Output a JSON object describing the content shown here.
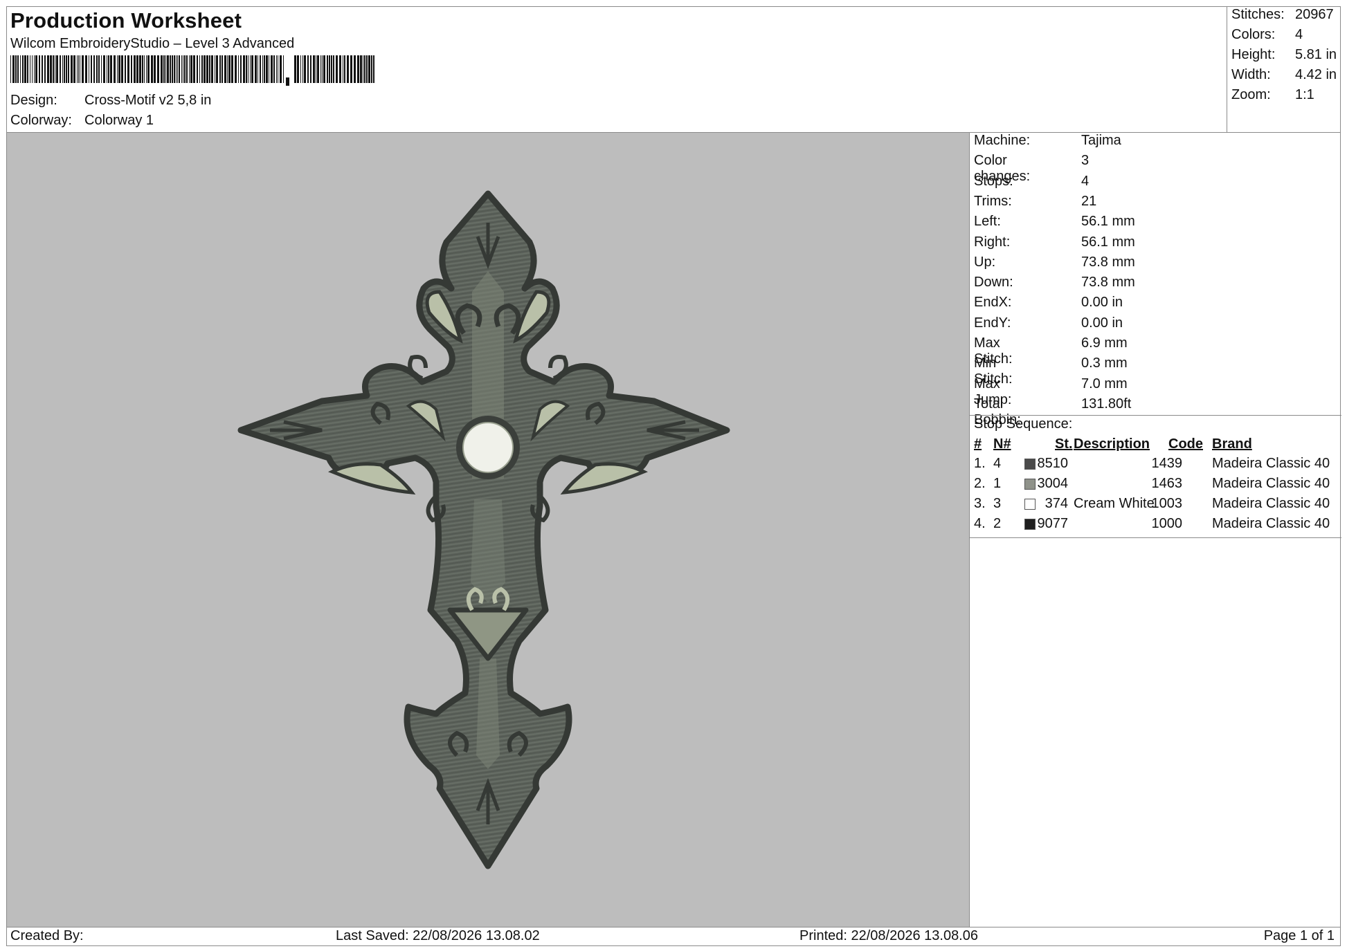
{
  "header": {
    "title": "Production Worksheet",
    "subtitle": "Wilcom EmbroideryStudio – Level 3 Advanced",
    "design_label": "Design:",
    "design_value": "Cross-Motif v2 5,8 in",
    "colorway_label": "Colorway:",
    "colorway_value": "Colorway 1"
  },
  "summary": [
    {
      "label": "Stitches:",
      "value": "20967"
    },
    {
      "label": "Colors:",
      "value": "4"
    },
    {
      "label": "Height:",
      "value": "5.81 in"
    },
    {
      "label": "Width:",
      "value": "4.42 in"
    },
    {
      "label": "Zoom:",
      "value": "1:1"
    }
  ],
  "machine_info": [
    {
      "label": "Machine:",
      "value": "Tajima"
    },
    {
      "label": "Color changes:",
      "value": "3"
    },
    {
      "label": "Stops:",
      "value": "4"
    },
    {
      "label": "Trims:",
      "value": "21"
    },
    {
      "label": "Left:",
      "value": "56.1 mm"
    },
    {
      "label": "Right:",
      "value": "56.1 mm"
    },
    {
      "label": "Up:",
      "value": "73.8 mm"
    },
    {
      "label": "Down:",
      "value": "73.8 mm"
    },
    {
      "label": "EndX:",
      "value": "0.00 in"
    },
    {
      "label": "EndY:",
      "value": "0.00 in"
    },
    {
      "label": "Max Stitch:",
      "value": "6.9 mm"
    },
    {
      "label": "Min Stitch:",
      "value": "0.3 mm"
    },
    {
      "label": "Max Jump:",
      "value": "7.0 mm"
    },
    {
      "label": "Total Bobbin:",
      "value": "131.80ft"
    }
  ],
  "stop_sequence": {
    "title": "Stop Sequence:",
    "headers": {
      "num": "#",
      "n": "N#",
      "st": "St.",
      "description": "Description",
      "code": "Code",
      "brand": "Brand"
    },
    "rows": [
      {
        "num": "1.",
        "n": "4",
        "color": "#4a4a4a",
        "st": "8510",
        "description": "",
        "code": "1439",
        "brand": "Madeira Classic 40"
      },
      {
        "num": "2.",
        "n": "1",
        "color": "#8f928a",
        "st": "3004",
        "description": "",
        "code": "1463",
        "brand": "Madeira Classic 40"
      },
      {
        "num": "3.",
        "n": "3",
        "color": "#ffffff",
        "st": "374",
        "description": "Cream White",
        "code": "1003",
        "brand": "Madeira Classic 40"
      },
      {
        "num": "4.",
        "n": "2",
        "color": "#1e1e1e",
        "st": "9077",
        "description": "",
        "code": "1000",
        "brand": "Madeira Classic 40"
      }
    ]
  },
  "footer": {
    "created_by": "Created By:",
    "last_saved": "Last Saved: 22/08/2026 13.08.02",
    "printed": "Printed: 22/08/2026 13.08.06",
    "page": "Page 1 of 1"
  },
  "preview": {
    "background": "#bdbdbd",
    "outline_color": "#3b3f3b",
    "fill_color": "#5f665e",
    "highlight_color": "#b9c0a8",
    "center_color": "#f0f1ea"
  }
}
